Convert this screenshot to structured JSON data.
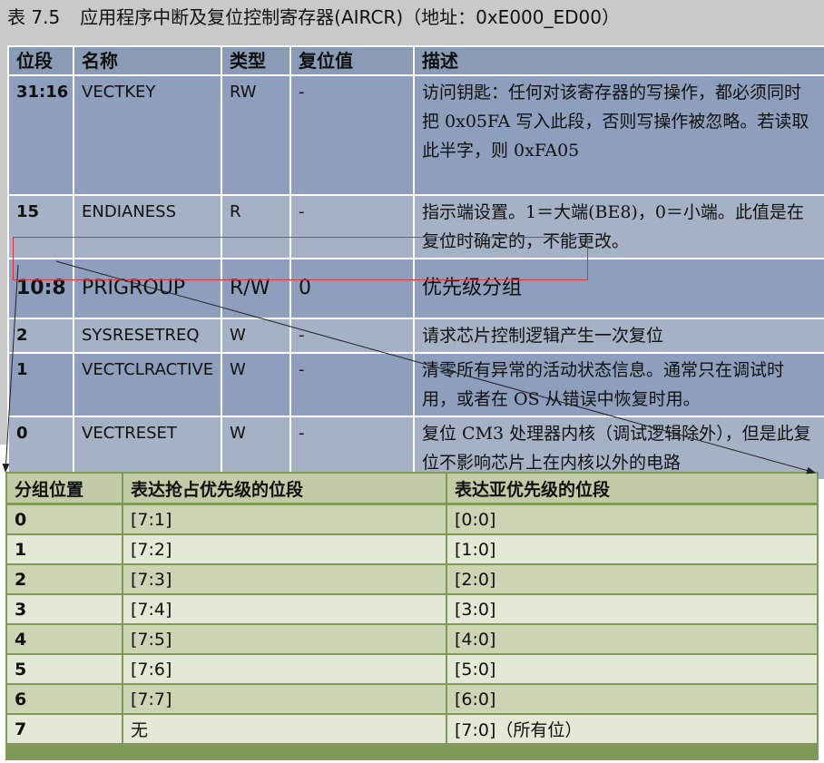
{
  "aircr": {
    "caption_number": "表 7.5",
    "caption_title": "应用程序中断及复位控制寄存器(AIRCR)（地址：0xE000_ED00）",
    "headers": [
      "位段",
      "名称",
      "类型",
      "复位值",
      "描述"
    ],
    "rows": [
      {
        "bits": "31:16",
        "name": "VECTKEY",
        "type": "RW",
        "reset": "-",
        "desc": "访问钥匙：任何对该寄存器的写操作，都必须同时把 0x05FA 写入此段，否则写操作被忽略。若读取此半字，则 0xFA05"
      },
      {
        "bits": "15",
        "name": "ENDIANESS",
        "type": "R",
        "reset": "-",
        "desc": "指示端设置。1＝大端(BE8)，0＝小端。此值是在复位时确定的，不能更改。"
      },
      {
        "bits": "10:8",
        "name": "PRIGROUP",
        "type": "R/W",
        "reset": "0",
        "desc": "优先级分组"
      },
      {
        "bits": "2",
        "name": "SYSRESETREQ",
        "type": "W",
        "reset": "-",
        "desc": "请求芯片控制逻辑产生一次复位"
      },
      {
        "bits": "1",
        "name": "VECTCLRACTIVE",
        "type": "W",
        "reset": "-",
        "desc": "清零所有异常的活动状态信息。通常只在调试时用，或者在 OS 从错误中恢复时用。"
      },
      {
        "bits": "0",
        "name": "VECTRESET",
        "type": "W",
        "reset": "-",
        "desc": "复位 CM3 处理器内核（调试逻辑除外），但是此复位不影响芯片上在内核以外的电路"
      }
    ]
  },
  "prigroup": {
    "headers": [
      "分组位置",
      "表达抢占优先级的位段",
      "表达亚优先级的位段"
    ],
    "rows": [
      {
        "group": "0",
        "preempt": "[7:1]",
        "sub": "[0:0]"
      },
      {
        "group": "1",
        "preempt": "[7:2]",
        "sub": "[1:0]"
      },
      {
        "group": "2",
        "preempt": "[7:3]",
        "sub": "[2:0]"
      },
      {
        "group": "3",
        "preempt": "[7:4]",
        "sub": "[3:0]"
      },
      {
        "group": "4",
        "preempt": "[7:5]",
        "sub": "[4:0]"
      },
      {
        "group": "5",
        "preempt": "[7:6]",
        "sub": "[5:0]"
      },
      {
        "group": "6",
        "preempt": "[7:7]",
        "sub": "[6:0]"
      },
      {
        "group": "7",
        "preempt": "无",
        "sub": "[7:0]（所有位）"
      }
    ]
  },
  "colors": {
    "aircr_header": "#8a9bb5",
    "aircr_row_dark": "#8d9fbc",
    "aircr_row_light": "#a5b2c5",
    "highlight_border": "#e0303a",
    "prigroup_border": "#7f9a57",
    "prigroup_header": "#c1cca7"
  }
}
